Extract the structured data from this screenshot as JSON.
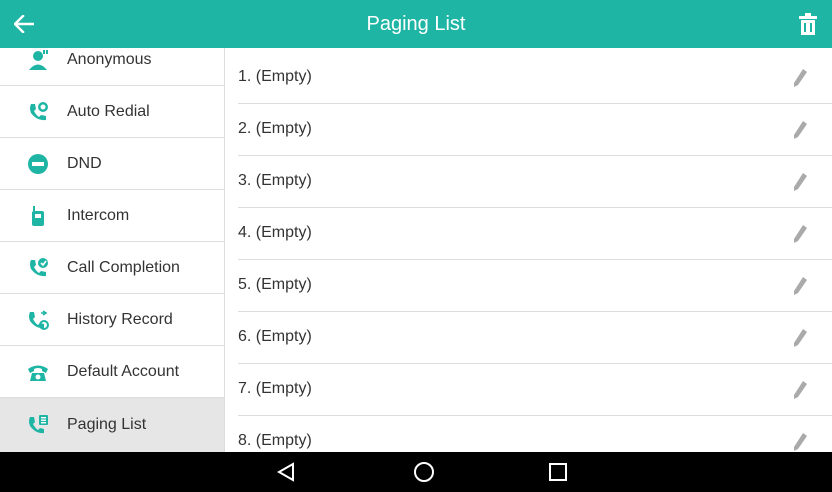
{
  "header": {
    "title": "Paging List",
    "back_icon": "arrow-left-icon",
    "action_icon": "trash-icon"
  },
  "sidebar": {
    "items": [
      {
        "label": "Anonymous",
        "icon": "anonymous-user-icon"
      },
      {
        "label": "Auto Redial",
        "icon": "phone-redial-icon"
      },
      {
        "label": "DND",
        "icon": "do-not-disturb-icon"
      },
      {
        "label": "Intercom",
        "icon": "intercom-icon"
      },
      {
        "label": "Call Completion",
        "icon": "call-completion-icon"
      },
      {
        "label": "History Record",
        "icon": "history-record-icon"
      },
      {
        "label": "Default Account",
        "icon": "telephone-icon"
      },
      {
        "label": "Paging List",
        "icon": "paging-list-icon",
        "selected": true
      }
    ]
  },
  "paging_list": {
    "rows": [
      {
        "label": "1. (Empty)"
      },
      {
        "label": "2. (Empty)"
      },
      {
        "label": "3. (Empty)"
      },
      {
        "label": "4. (Empty)"
      },
      {
        "label": "5. (Empty)"
      },
      {
        "label": "6. (Empty)"
      },
      {
        "label": "7. (Empty)"
      },
      {
        "label": "8. (Empty)"
      }
    ],
    "row_action_icon": "pencil-edit-icon"
  },
  "navigation_bar": {
    "buttons": [
      "back-triangle-icon",
      "home-circle-icon",
      "recents-square-icon"
    ]
  },
  "colors": {
    "accent": "#1fb5a5",
    "selected_row": "#e6e6e6",
    "divider": "#dddddd",
    "nav_bar": "#000000"
  }
}
